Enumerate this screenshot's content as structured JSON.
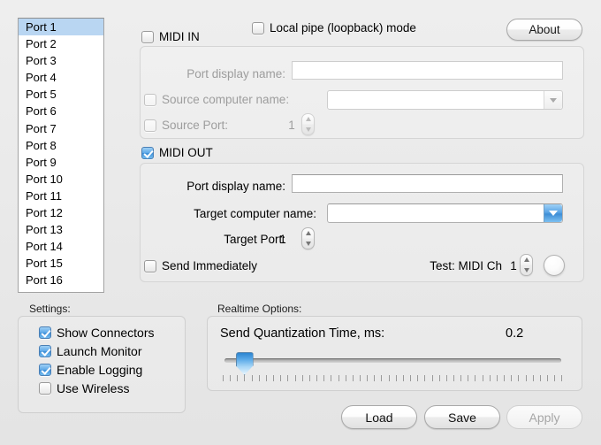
{
  "port_list": {
    "items": [
      "Port 1",
      "Port 2",
      "Port 3",
      "Port 4",
      "Port 5",
      "Port 6",
      "Port 7",
      "Port 8",
      "Port 9",
      "Port 10",
      "Port 11",
      "Port 12",
      "Port 13",
      "Port 14",
      "Port 15",
      "Port 16"
    ],
    "selected_index": 0,
    "selection_color": "#b9d6f2"
  },
  "header": {
    "midi_in_label": "MIDI IN",
    "midi_in_checked": false,
    "local_pipe_label": "Local pipe (loopback) mode",
    "local_pipe_checked": false,
    "about_label": "About"
  },
  "midi_in": {
    "port_display_name_label": "Port display name:",
    "port_display_name_value": "",
    "source_computer_label": "Source computer name:",
    "source_computer_checked": false,
    "source_computer_value": "",
    "source_port_label": "Source Port:",
    "source_port_checked": false,
    "source_port_value": "1",
    "enabled": false
  },
  "midi_out": {
    "section_label": "MIDI OUT",
    "section_checked": true,
    "port_display_name_label": "Port display name:",
    "port_display_name_value": "",
    "target_computer_label": "Target computer name:",
    "target_computer_value": "",
    "target_port_label": "Target Port:",
    "target_port_value": "1",
    "send_immediately_label": "Send Immediately",
    "send_immediately_checked": false,
    "test_label": "Test: MIDI Ch",
    "test_value": "1",
    "enabled": true
  },
  "settings": {
    "caption": "Settings:",
    "items": [
      {
        "label": "Show Connectors",
        "checked": true
      },
      {
        "label": "Launch Monitor",
        "checked": true
      },
      {
        "label": "Enable Logging",
        "checked": true
      },
      {
        "label": "Use Wireless",
        "checked": false
      }
    ]
  },
  "realtime": {
    "caption": "Realtime Options:",
    "quant_label": "Send Quantization Time, ms:",
    "quant_value": "0.2",
    "slider_percent": 4,
    "tick_count": 48
  },
  "footer": {
    "load_label": "Load",
    "save_label": "Save",
    "apply_label": "Apply",
    "apply_enabled": false
  },
  "colors": {
    "window_bg": "#ececec",
    "accent_blue": "#3d8fd8",
    "selection": "#b9d6f2",
    "disabled_text": "#9d9d9d"
  }
}
